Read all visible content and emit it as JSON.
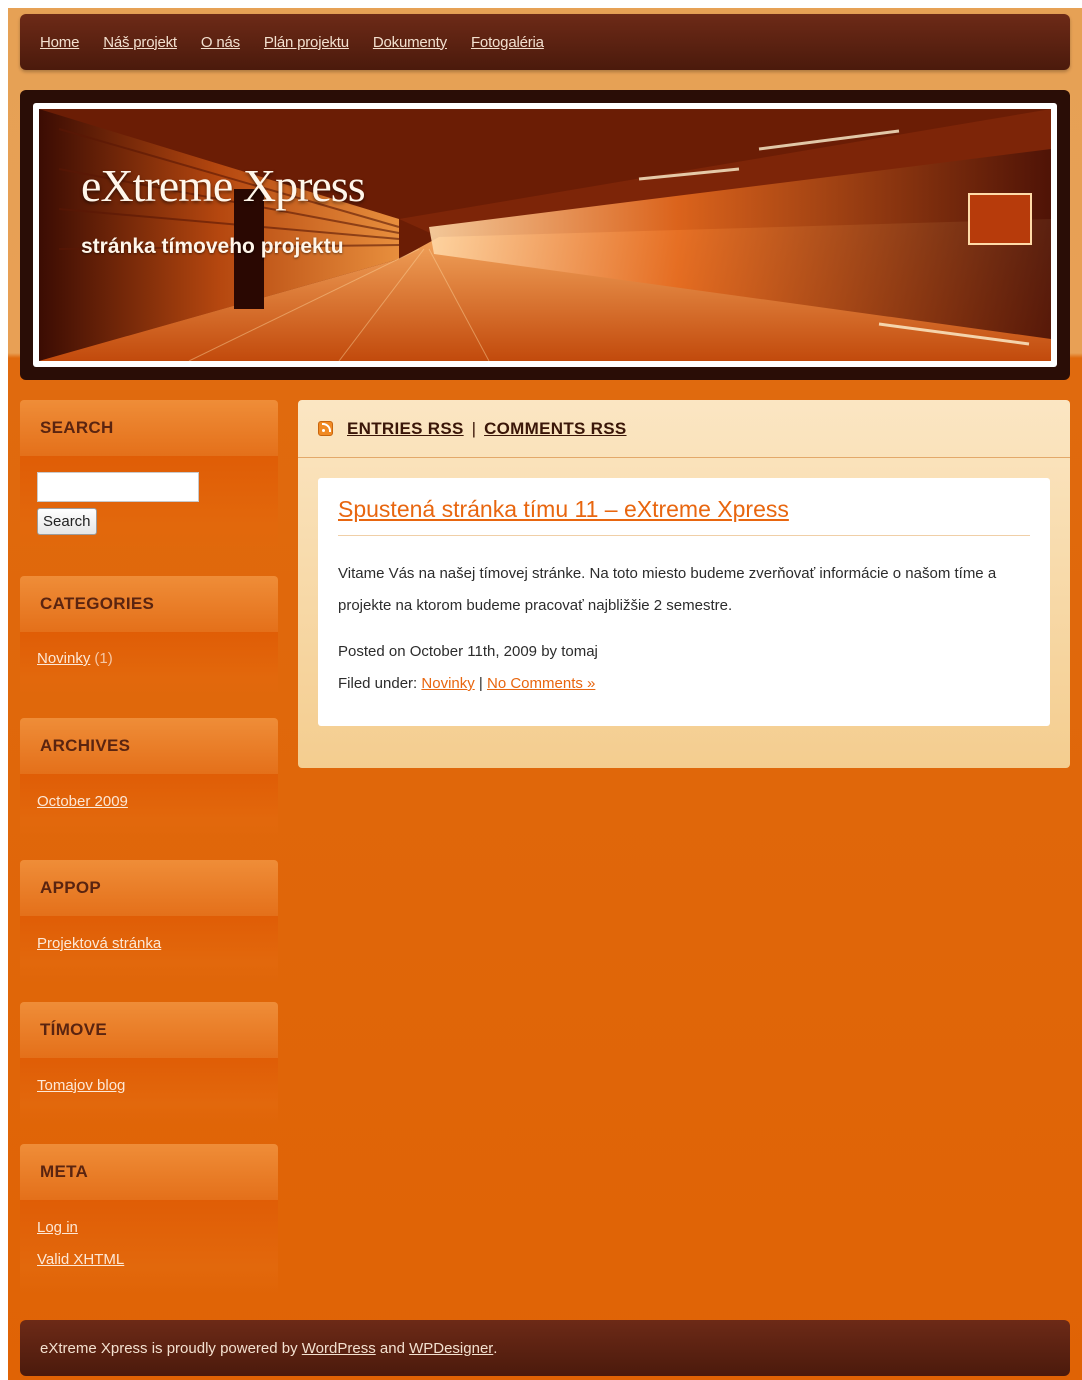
{
  "nav": {
    "items": [
      "Home",
      "Náš projekt",
      "O nás",
      "Plán projektu",
      "Dokumenty",
      "Fotogaléria"
    ]
  },
  "header": {
    "title": "eXtreme Xpress",
    "description": "stránka tímoveho projektu"
  },
  "sidebar": {
    "search": {
      "title": "SEARCH",
      "button": "Search",
      "value": ""
    },
    "categories": {
      "title": "CATEGORIES",
      "item": "Novinky",
      "count": "(1)"
    },
    "archives": {
      "title": "ARCHIVES",
      "item": "October 2009"
    },
    "appop": {
      "title": "APPOP",
      "item": "Projektová stránka"
    },
    "timove": {
      "title": "TÍMOVE",
      "item": "Tomajov blog"
    },
    "meta": {
      "title": "META",
      "items": [
        "Log in",
        "Valid XHTML"
      ]
    }
  },
  "main": {
    "rss": {
      "entries": "ENTRIES RSS",
      "separator": "|",
      "comments": "COMMENTS RSS"
    },
    "post": {
      "title": "Spustená stránka tímu 11 – eXtreme Xpress",
      "body": "Vitame Vás na našej tímovej stránke. Na toto miesto budeme zverňovať informácie o našom tíme a projekte na ktorom budeme pracovať najbližšie 2 semestre.",
      "posted": "Posted on October 11th, 2009 by tomaj",
      "filed_label": "Filed under:",
      "filed_category": "Novinky",
      "filed_sep": "|",
      "comments_link": "No Comments »"
    }
  },
  "footer": {
    "text_before": "eXtreme Xpress is proudly powered by",
    "link1": "WordPress",
    "and": "and",
    "link2": "WPDesigner",
    "text_after": "."
  },
  "colors": {
    "accent": "#e8660f",
    "nav_bg": "#5c2211",
    "page_orange": "#e06305"
  }
}
